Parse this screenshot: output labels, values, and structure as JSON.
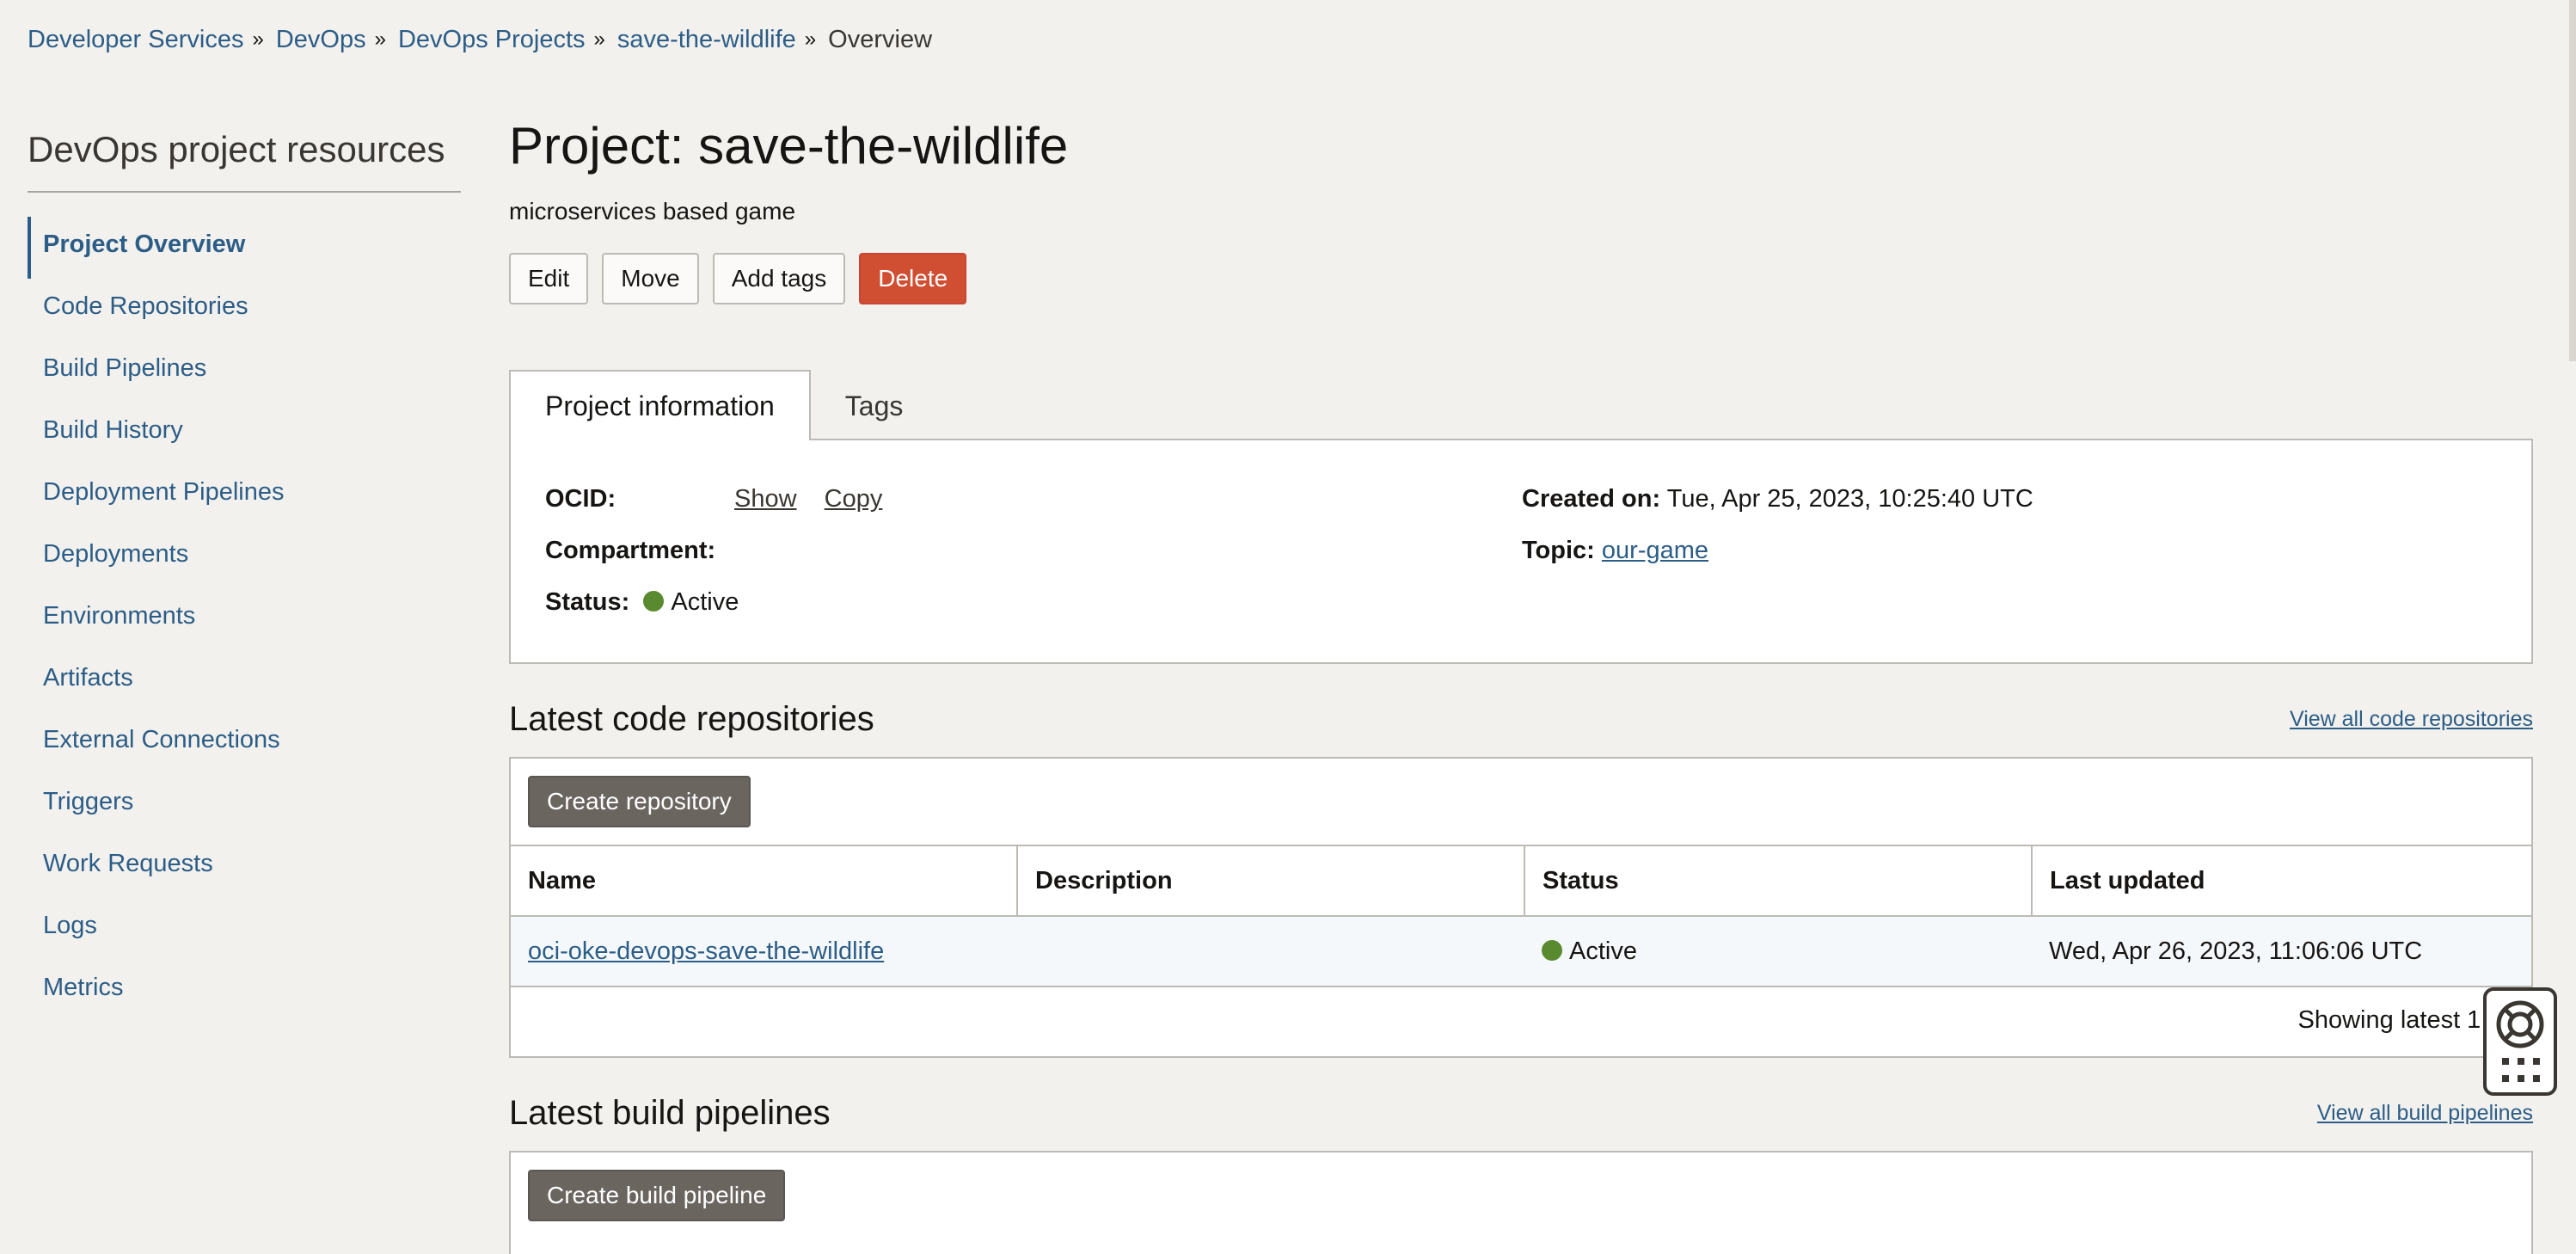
{
  "breadcrumb": {
    "items": [
      "Developer Services",
      "DevOps",
      "DevOps Projects",
      "save-the-wildlife"
    ],
    "current": "Overview",
    "separator": "»"
  },
  "sidebar": {
    "title": "DevOps project resources",
    "items": [
      {
        "label": "Project Overview",
        "active": true
      },
      {
        "label": "Code Repositories"
      },
      {
        "label": "Build Pipelines"
      },
      {
        "label": "Build History"
      },
      {
        "label": "Deployment Pipelines"
      },
      {
        "label": "Deployments"
      },
      {
        "label": "Environments"
      },
      {
        "label": "Artifacts"
      },
      {
        "label": "External Connections"
      },
      {
        "label": "Triggers"
      },
      {
        "label": "Work Requests"
      },
      {
        "label": "Logs"
      },
      {
        "label": "Metrics"
      }
    ]
  },
  "project": {
    "title": "Project: save-the-wildlife",
    "description": "microservices based game",
    "actions": {
      "edit": "Edit",
      "move": "Move",
      "add_tags": "Add tags",
      "delete": "Delete"
    }
  },
  "tabs": {
    "info": "Project information",
    "tags": "Tags"
  },
  "info": {
    "ocid_label": "OCID:",
    "show": "Show",
    "copy": "Copy",
    "compartment_label": "Compartment:",
    "status_label": "Status:",
    "status_value": "Active",
    "created_label": "Created on:",
    "created_value": "Tue, Apr 25, 2023, 10:25:40 UTC",
    "topic_label": "Topic:",
    "topic_value": "our-game"
  },
  "repos": {
    "title": "Latest code repositories",
    "view_all": "View all code repositories",
    "create": "Create repository",
    "columns": [
      "Name",
      "Description",
      "Status",
      "Last updated"
    ],
    "rows": [
      {
        "name": "oci-oke-devops-save-the-wildlife",
        "description": "",
        "status": "Active",
        "updated": "Wed, Apr 26, 2023, 11:06:06 UTC"
      }
    ],
    "footer": "Showing latest 1 ite"
  },
  "pipelines": {
    "title": "Latest build pipelines",
    "view_all": "View all build pipelines",
    "create": "Create build pipeline"
  },
  "colors": {
    "link": "#2c5d87",
    "danger": "#d04e32",
    "status_active": "#5a8a2f",
    "background": "#f2f1ee"
  },
  "icons": {
    "help": "lifebuoy-icon",
    "apps": "grid-icon"
  }
}
